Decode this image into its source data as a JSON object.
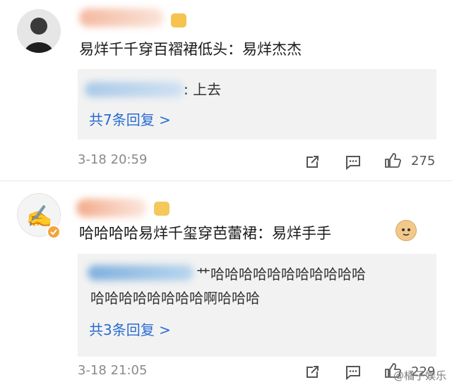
{
  "comments": [
    {
      "text": "易烊千千穿百褶裙低头：易烊杰杰",
      "reply_preview": ": 上去",
      "view_replies": "共7条回复 >",
      "timestamp": "3-18 20:59",
      "likes": "275",
      "icons": [
        "share-icon",
        "comment-icon",
        "like-icon",
        "crown-badge-icon"
      ]
    },
    {
      "text": "哈哈哈哈易烊千玺穿芭蕾裙：易烊手手",
      "reply_line1": "艹哈哈哈哈哈哈哈哈哈哈哈",
      "reply_line2": "哈哈哈哈哈哈哈哈啊哈哈哈",
      "view_replies": "共3条回复 >",
      "timestamp": "3-18 21:05",
      "likes": "229",
      "icons": [
        "share-icon",
        "comment-icon",
        "like-icon",
        "verified-badge-icon",
        "cat-emoji-icon"
      ]
    }
  ],
  "watermark": "@橘子娱乐",
  "colors": {
    "link": "#2a6bd0",
    "meta": "#8a8a8a",
    "reply_bg": "#f2f2f2",
    "verified": "#f3a43b"
  }
}
